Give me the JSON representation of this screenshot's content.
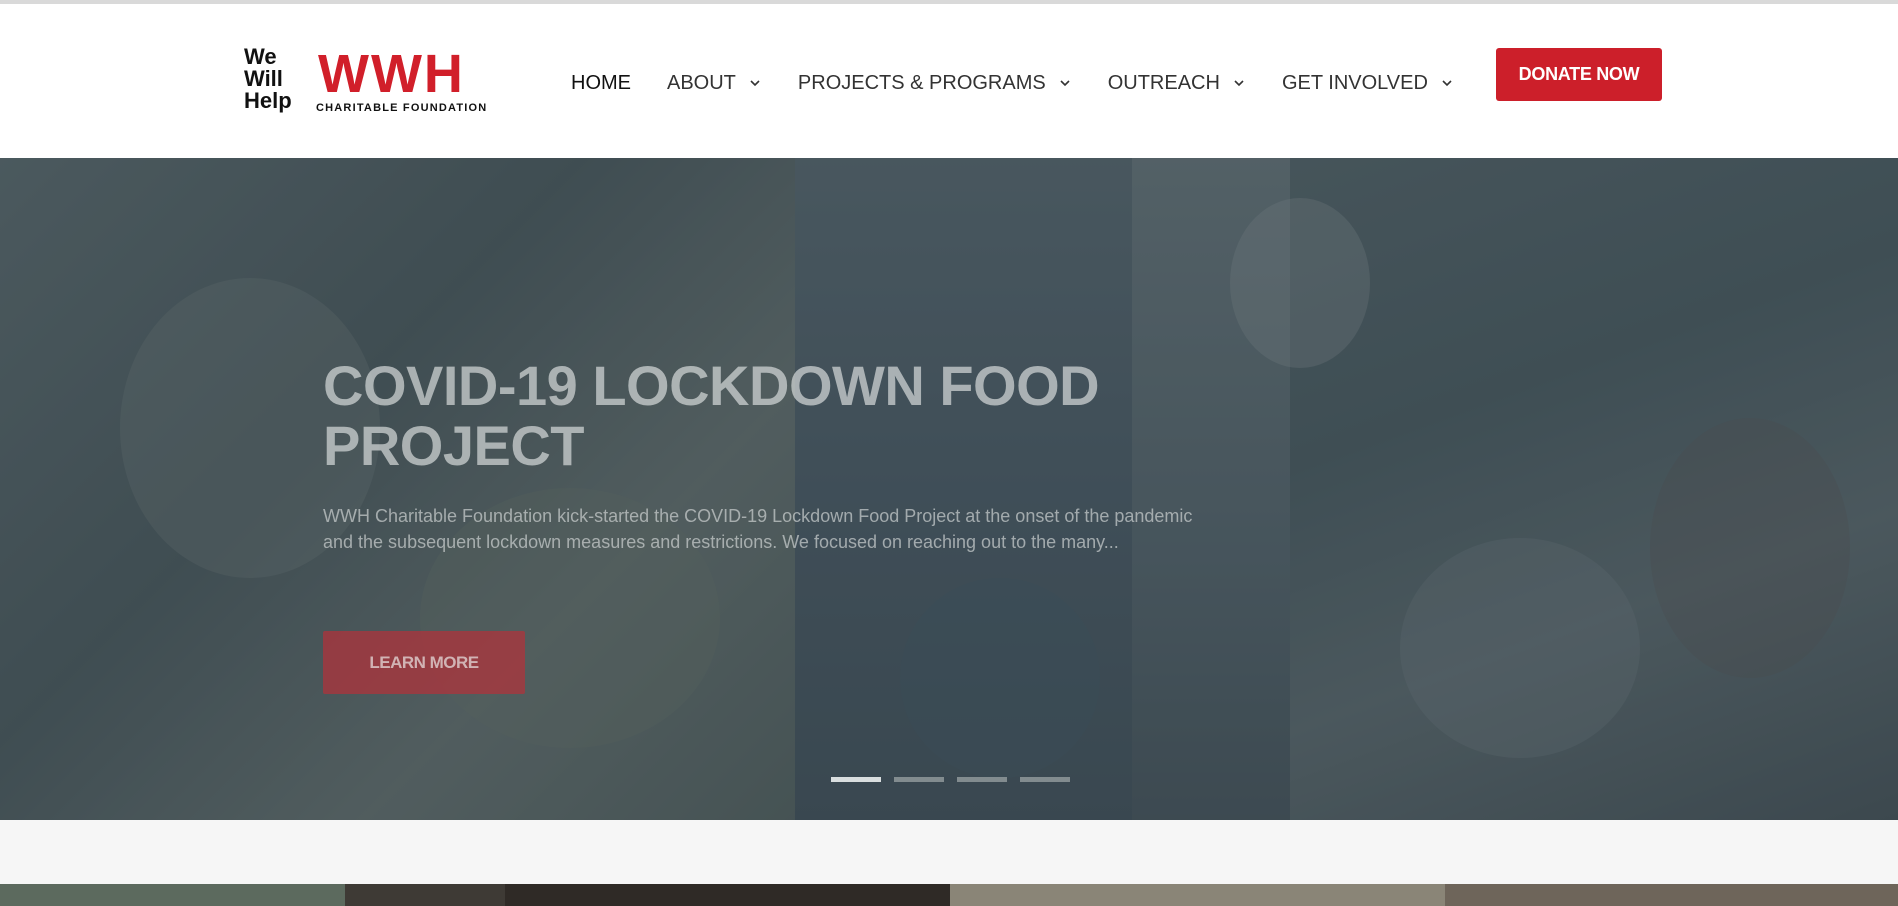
{
  "header": {
    "logo": {
      "left_lines": [
        "We",
        "Will",
        "Help"
      ],
      "big": "WWH",
      "sub": "CHARITABLE FOUNDATION"
    },
    "nav": [
      {
        "label": "HOME",
        "has_dropdown": false,
        "active": true
      },
      {
        "label": "ABOUT",
        "has_dropdown": true,
        "active": false
      },
      {
        "label": "PROJECTS & PROGRAMS",
        "has_dropdown": true,
        "active": false
      },
      {
        "label": "OUTREACH",
        "has_dropdown": true,
        "active": false
      },
      {
        "label": "GET INVOLVED",
        "has_dropdown": true,
        "active": false
      }
    ],
    "donate_label": "DONATE NOW"
  },
  "hero": {
    "title": "COVID-19 LOCKDOWN FOOD PROJECT",
    "text": "WWH Charitable Foundation kick-started the COVID-19 Lockdown Food Project at the onset of the pandemic and the subsequent lockdown measures and restrictions. We focused on reaching out to the many...",
    "button_label": "LEARN MORE",
    "slides_count": 4,
    "active_slide": 1
  },
  "colors": {
    "brand_red": "#cc1f2a",
    "overlay": "#324148"
  }
}
